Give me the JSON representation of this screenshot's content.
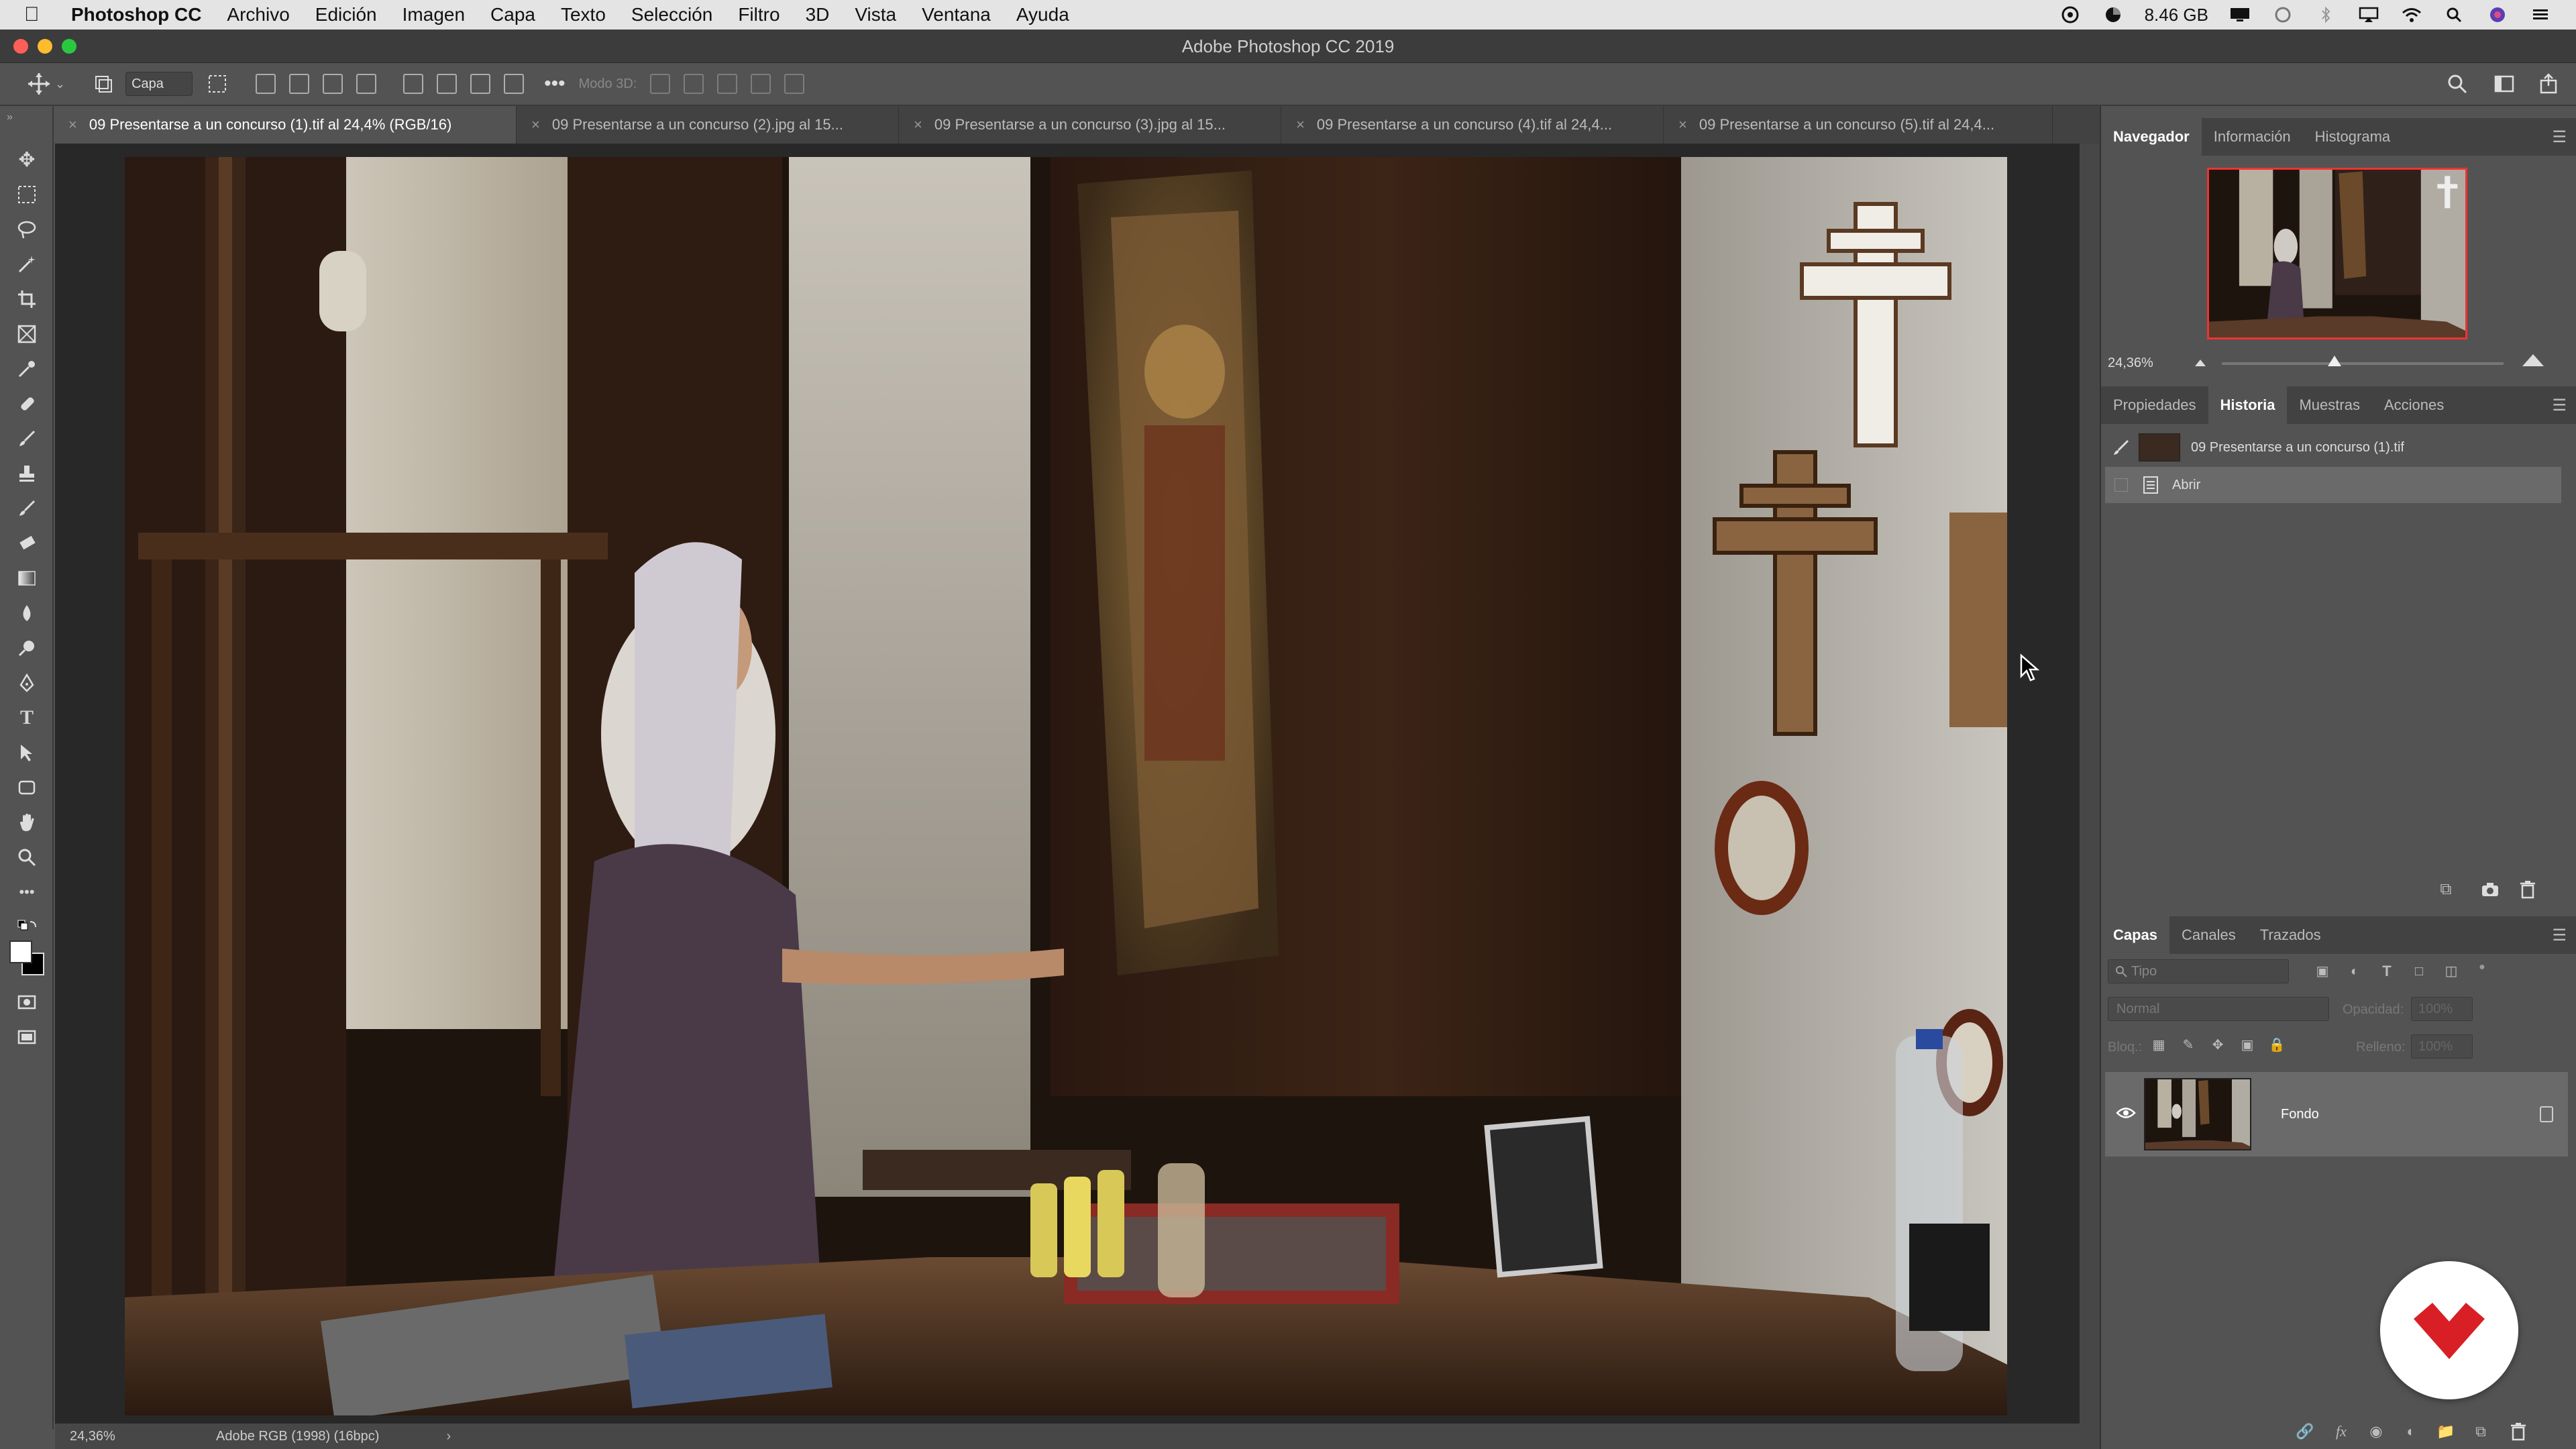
{
  "menubar": {
    "app_name": "Photoshop CC",
    "items": [
      "Archivo",
      "Edición",
      "Imagen",
      "Capa",
      "Texto",
      "Selección",
      "Filtro",
      "3D",
      "Vista",
      "Ventana",
      "Ayuda"
    ],
    "memory": "8.46 GB"
  },
  "window": {
    "title": "Adobe Photoshop CC 2019"
  },
  "options": {
    "auto_select_target": "Capa",
    "mode_3d_label": "Modo 3D:"
  },
  "tabs": [
    "09 Presentarse a un concurso (1).tif al 24,4% (RGB/16)",
    "09 Presentarse a un concurso (2).jpg al 15...",
    "09 Presentarse a un concurso (3).jpg al 15...",
    "09 Presentarse a un concurso (4).tif al 24,4...",
    "09 Presentarse a un concurso (5).tif al 24,4..."
  ],
  "status": {
    "zoom": "24,36%",
    "profile": "Adobe RGB (1998) (16bpc)"
  },
  "navigator": {
    "tabs": [
      "Navegador",
      "Información",
      "Histograma"
    ],
    "zoom": "24,36%",
    "zoom_level_fraction": 0.43
  },
  "history": {
    "tabs": [
      "Propiedades",
      "Historia",
      "Muestras",
      "Acciones"
    ],
    "snapshot_label": "09 Presentarse a un concurso (1).tif",
    "states": [
      "Abrir"
    ]
  },
  "layers": {
    "tabs": [
      "Capas",
      "Canales",
      "Trazados"
    ],
    "filter_placeholder": "Tipo",
    "blend_mode": "Normal",
    "opacity_label": "Opacidad:",
    "opacity_value": "100%",
    "lock_label": "Bloq.:",
    "fill_label": "Relleno:",
    "fill_value": "100%",
    "items": [
      {
        "name": "Fondo"
      }
    ]
  },
  "colors": {
    "accent_red": "#e33333",
    "panel_bg": "#535353",
    "canvas_bg": "#282828"
  }
}
